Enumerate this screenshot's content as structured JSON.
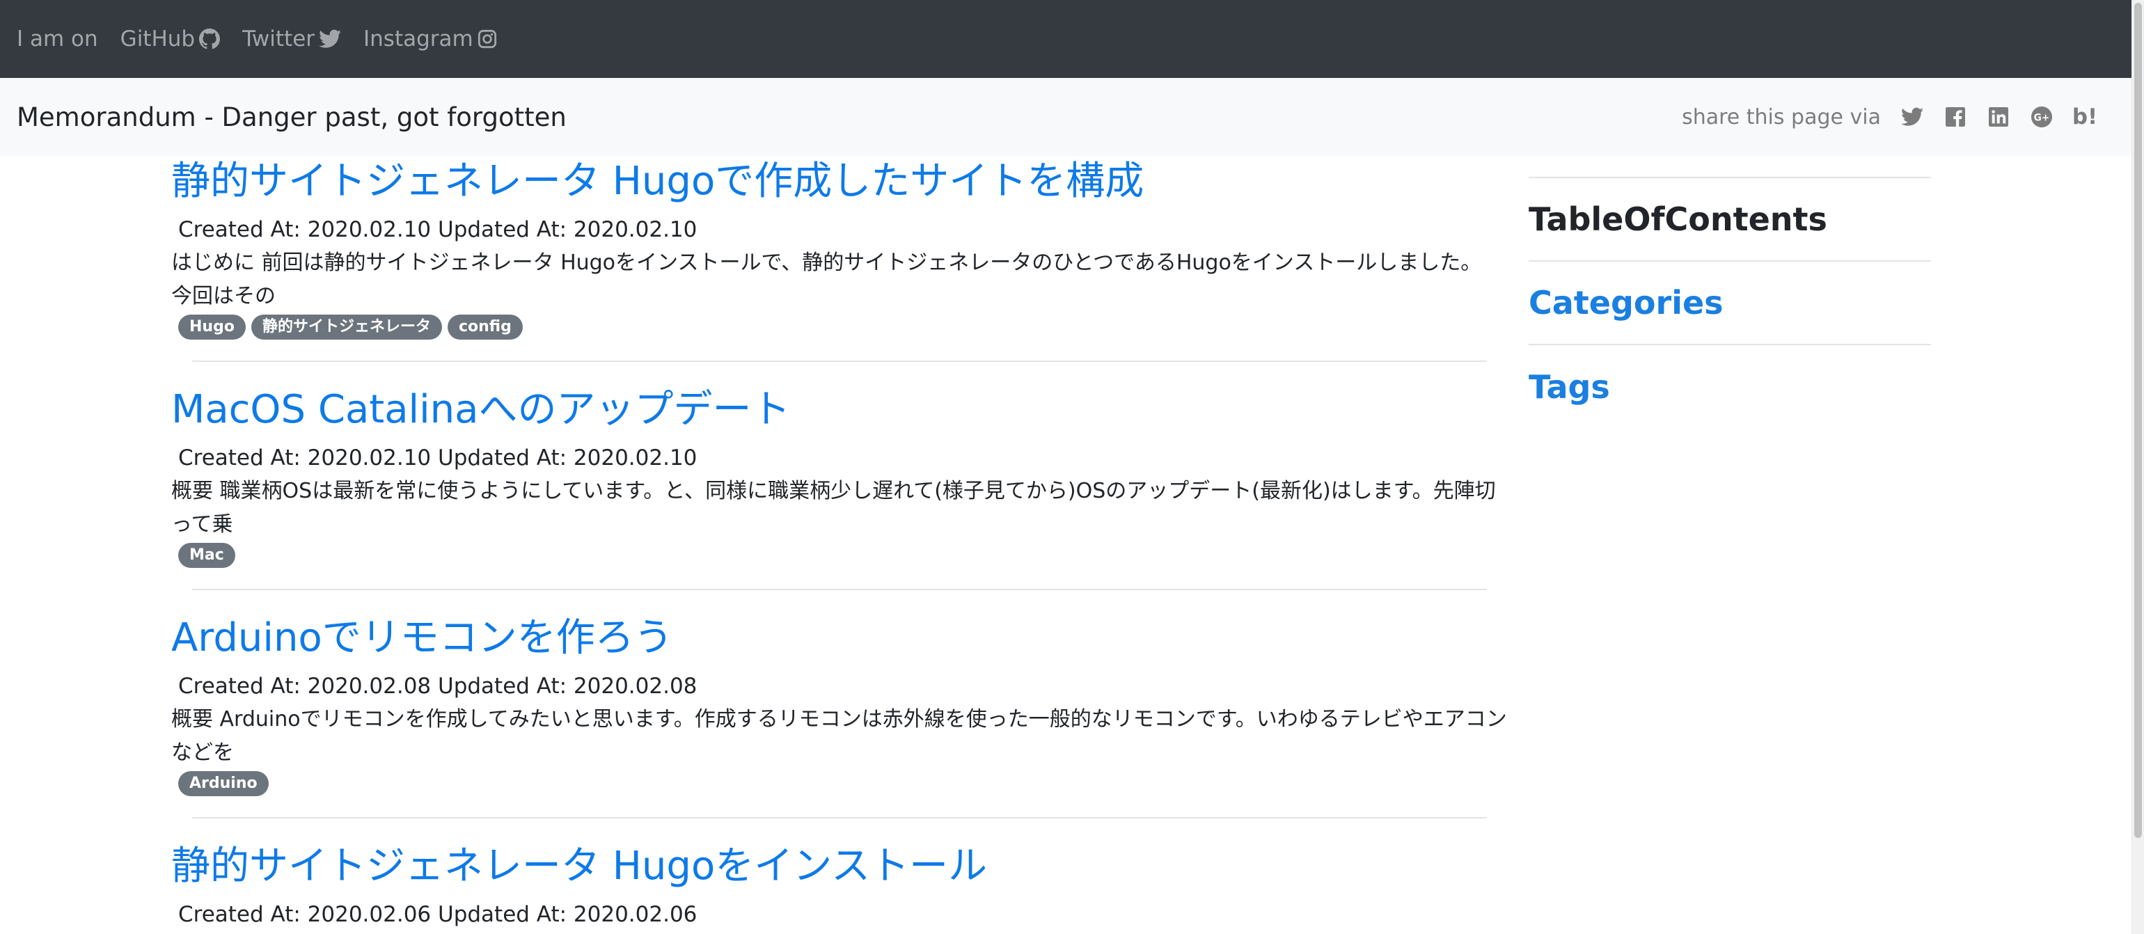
{
  "topnav": {
    "intro": "I am on",
    "links": [
      {
        "label": "GitHub",
        "icon": "github-icon"
      },
      {
        "label": "Twitter",
        "icon": "twitter-icon"
      },
      {
        "label": "Instagram",
        "icon": "instagram-icon"
      }
    ]
  },
  "header": {
    "brand": "Memorandum - Danger past, got forgotten",
    "share_label": "share this page via",
    "share_icons": [
      "twitter-icon",
      "facebook-icon",
      "linkedin-icon",
      "google-plus-icon",
      "hatena-bookmark-icon"
    ],
    "hatena_text": "b!"
  },
  "posts": [
    {
      "title": "静的サイトジェネレータ Hugoで作成したサイトを構成",
      "meta": "Created At: 2020.02.10 Updated At: 2020.02.10",
      "excerpt": "はじめに 前回は静的サイトジェネレータ Hugoをインストールで、静的サイトジェネレータのひとつであるHugoをインストールしました。 今回はその",
      "tags": [
        "Hugo",
        "静的サイトジェネレータ",
        "config"
      ]
    },
    {
      "title": "MacOS Catalinaへのアップデート",
      "meta": "Created At: 2020.02.10 Updated At: 2020.02.10",
      "excerpt": "概要 職業柄OSは最新を常に使うようにしています。と、同様に職業柄少し遅れて(様子見てから)OSのアップデート(最新化)はします。先陣切って乗",
      "tags": [
        "Mac"
      ]
    },
    {
      "title": "Arduinoでリモコンを作ろう",
      "meta": "Created At: 2020.02.08 Updated At: 2020.02.08",
      "excerpt": "概要 Arduinoでリモコンを作成してみたいと思います。作成するリモコンは赤外線を使った一般的なリモコンです。いわゆるテレビやエアコンなどを",
      "tags": [
        "Arduino"
      ]
    },
    {
      "title": "静的サイトジェネレータ Hugoをインストール",
      "meta": "Created At: 2020.02.06 Updated At: 2020.02.06"
    }
  ],
  "sidebar": {
    "toc": "TableOfContents",
    "categories": "Categories",
    "tags": "Tags"
  },
  "colors": {
    "topbar": "#343a40",
    "header": "#f8f9fa",
    "link": "#0d7ae8",
    "badge": "#6c757d"
  }
}
